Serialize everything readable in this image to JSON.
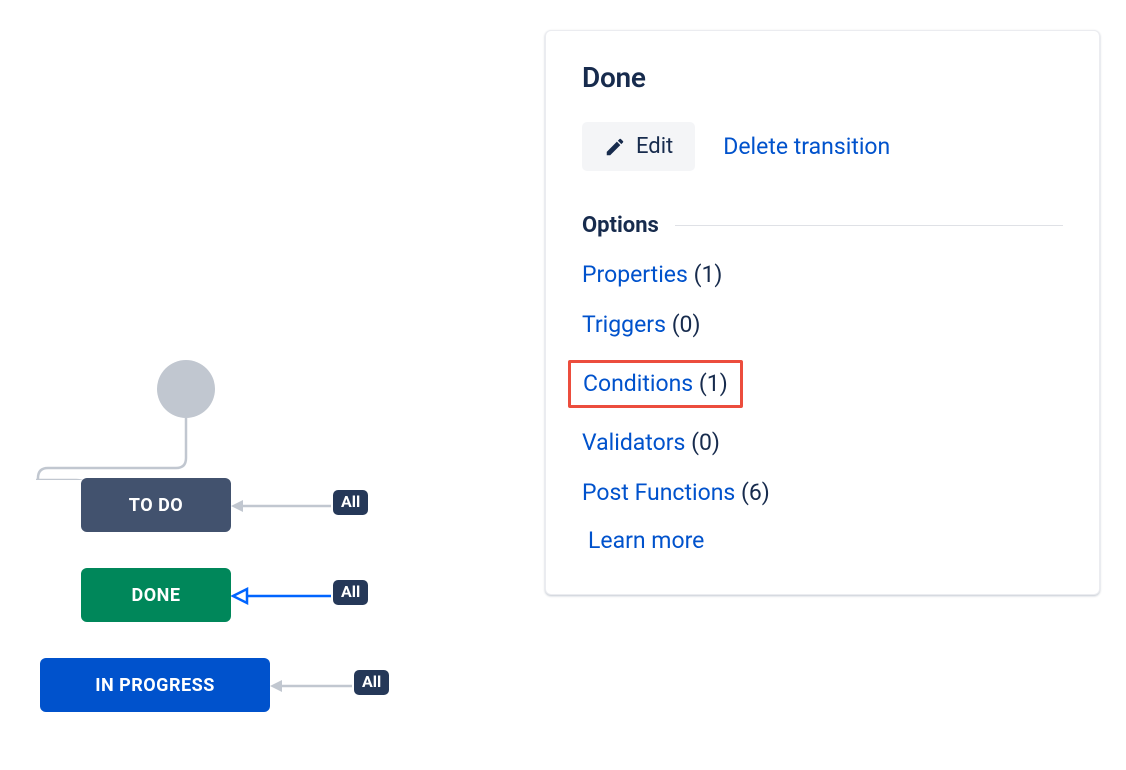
{
  "workflow": {
    "nodes": {
      "todo": "TO DO",
      "done": "DONE",
      "inprogress": "IN PROGRESS"
    },
    "badge": "All"
  },
  "panel": {
    "title": "Done",
    "edit_label": "Edit",
    "delete_label": "Delete transition",
    "options_label": "Options",
    "options": {
      "properties": {
        "label": "Properties",
        "count": "(1)"
      },
      "triggers": {
        "label": "Triggers",
        "count": "(0)"
      },
      "conditions": {
        "label": "Conditions",
        "count": "(1)"
      },
      "validators": {
        "label": "Validators",
        "count": "(0)"
      },
      "postfunctions": {
        "label": "Post Functions",
        "count": "(6)"
      }
    },
    "learn_more": "Learn more"
  }
}
